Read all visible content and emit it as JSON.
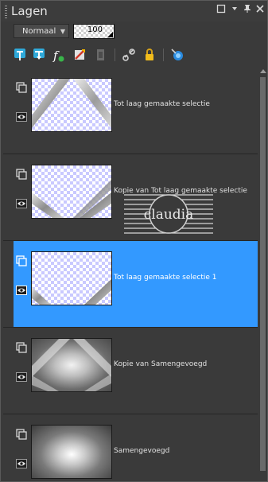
{
  "panel": {
    "title": "Lagen",
    "buttons": [
      "restore-icon",
      "dropdown-icon",
      "pin-icon",
      "close-icon"
    ]
  },
  "controls": {
    "blend_mode": "Normaal",
    "opacity": "100"
  },
  "toolbar": {
    "tools": [
      "new-raster-layer-icon",
      "new-vector-layer-icon",
      "new-adjustment-layer-icon",
      "edit-mask-icon",
      "delete-layer-icon",
      "link-icon",
      "lock-icon",
      "properties-icon"
    ]
  },
  "layers": [
    {
      "name": "Tot laag gemaakte selectie",
      "selected": false
    },
    {
      "name": "Kopie van Tot laag gemaakte selectie",
      "selected": false
    },
    {
      "name": "Tot laag gemaakte selectie 1",
      "selected": true
    },
    {
      "name": "Kopie van Samengevoegd",
      "selected": false
    },
    {
      "name": "Samengevoegd",
      "selected": false
    }
  ],
  "watermark": {
    "text": "claudia"
  },
  "colors": {
    "selection": "#3399ff",
    "panel_bg": "#3a3a3a"
  }
}
